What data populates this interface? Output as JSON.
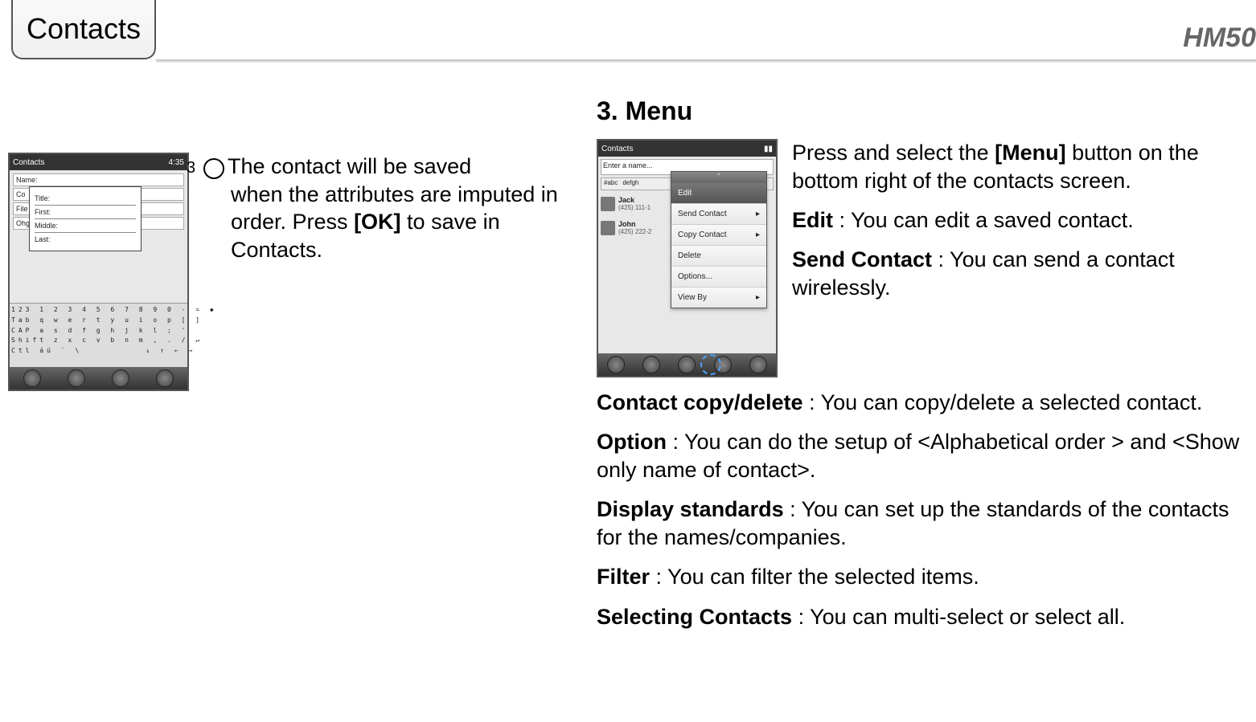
{
  "header": {
    "tab_label": "Contacts",
    "model": "HM50"
  },
  "left": {
    "step_number": "3",
    "step_text_1": "The contact will be saved",
    "step_text_cont": "when the attributes are imputed in order. Press ",
    "step_bold": "[OK]",
    "step_text_end": " to save in Contacts.",
    "screenshot1": {
      "title": "Contacts",
      "time": "4:35",
      "field_name_label": "Name:",
      "field_co_label": "Co",
      "field_file_label": "File",
      "field_ohgaq": "Ohgaq",
      "popup_title": "Title:",
      "popup_first": "First:",
      "popup_middle": "Middle:",
      "popup_last": "Last:",
      "kb_row1": "123 1 2 3 4 5 6 7 8 9 0 - = ◆",
      "kb_row2": "Tab q w e r t y u i o p [ ]",
      "kb_row3": "CAP a s d f g h j k l ; '",
      "kb_row4": "Shift z x c v b n m , . / ↵",
      "kb_row5": "Ctl áü ` \\         ↓ ↑ ← →"
    }
  },
  "right": {
    "section_title": "3. Menu",
    "intro_1": "Press and select the ",
    "intro_bold": "[Menu]",
    "intro_2": " button on the bottom right of the contacts screen.",
    "screenshot2": {
      "title": "Contacts",
      "search_placeholder": "Enter a name...",
      "tabs_a": "#abc",
      "tabs_b": "defgh",
      "contact1_name": "Jack",
      "contact1_num": "(425) 111-1",
      "contact2_name": "John",
      "contact2_num": "(425) 222-2",
      "menu_edit": "Edit",
      "menu_send": "Send Contact",
      "menu_copy": "Copy Contact",
      "menu_delete": "Delete",
      "menu_options": "Options...",
      "menu_viewby": "View By",
      "arrow": "▸"
    },
    "definitions": [
      {
        "term": "Edit",
        "desc": " : You can edit a saved contact."
      },
      {
        "term": "Send Contact",
        "desc": " : You can send a contact wirelessly."
      },
      {
        "term": "Contact copy/delete",
        "desc": " : You can copy/delete a selected contact."
      },
      {
        "term": "Option",
        "desc": " : You can do the setup of <Alphabetical order > and <Show only name of contact>."
      },
      {
        "term": "Display standards",
        "desc": " : You can set up the standards of the contacts for the names/companies."
      },
      {
        "term": "Filter",
        "desc": " : You can filter the selected items."
      },
      {
        "term": "Selecting Contacts",
        "desc": " : You can multi-select or select all."
      }
    ]
  }
}
